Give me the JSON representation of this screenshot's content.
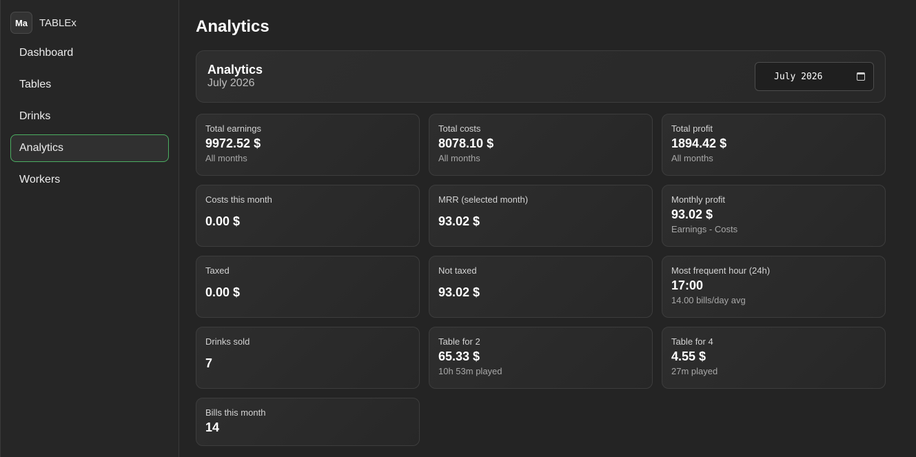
{
  "sidebar": {
    "avatar": "Ma",
    "brand": "TABLEx",
    "items": [
      {
        "label": "Dashboard"
      },
      {
        "label": "Tables"
      },
      {
        "label": "Drinks"
      },
      {
        "label": "Analytics"
      },
      {
        "label": "Workers"
      }
    ],
    "active_item": "Analytics"
  },
  "page": {
    "title": "Analytics"
  },
  "header": {
    "title": "Analytics",
    "subtitle": "July 2026",
    "month_input_value": "July 2026"
  },
  "cards": [
    {
      "label": "Total earnings",
      "value": "9972.52 $",
      "sub": "All months"
    },
    {
      "label": "Total costs",
      "value": "8078.10 $",
      "sub": "All months"
    },
    {
      "label": "Total profit",
      "value": "1894.42 $",
      "sub": "All months"
    },
    {
      "label": "Costs this month",
      "value": "0.00 $",
      "sub": ""
    },
    {
      "label": "MRR (selected month)",
      "value": "93.02 $",
      "sub": ""
    },
    {
      "label": "Monthly profit",
      "value": "93.02 $",
      "sub": "Earnings - Costs"
    },
    {
      "label": "Taxed",
      "value": "0.00 $",
      "sub": ""
    },
    {
      "label": "Not taxed",
      "value": "93.02 $",
      "sub": ""
    },
    {
      "label": "Most frequent hour (24h)",
      "value": "17:00",
      "sub": "14.00 bills/day avg"
    },
    {
      "label": "Drinks sold",
      "value": "7",
      "sub": ""
    },
    {
      "label": "Table for 2",
      "value": "65.33 $",
      "sub": "10h 53m played"
    },
    {
      "label": "Table for 4",
      "value": "4.55 $",
      "sub": "27m played"
    },
    {
      "label": "Bills this month",
      "value": "14",
      "sub": ""
    }
  ],
  "colors": {
    "background": "#242424",
    "active_border": "#4caf62"
  }
}
